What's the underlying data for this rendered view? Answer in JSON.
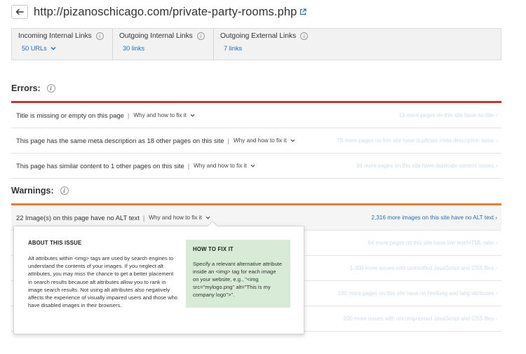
{
  "header": {
    "url": "http://pizanoschicago.com/private-party-rooms.php"
  },
  "stats": [
    {
      "label": "Incoming Internal Links",
      "value": "50 URLs"
    },
    {
      "label": "Outgoing Internal Links",
      "value": "30 links"
    },
    {
      "label": "Outgoing External Links",
      "value": "7 links"
    }
  ],
  "errors": {
    "title": "Errors:",
    "items": [
      {
        "text": "Title is missing or empty on this page",
        "fix": "Why and how to fix it",
        "right": "13 more pages on this site have no title ›"
      },
      {
        "text": "This page has the same meta description as 18 other pages on this site",
        "fix": "Why and how to fix it",
        "right": "78 more pages on this site have duplicate meta description issue ›"
      },
      {
        "text": "This page has similar content to 1 other pages on this site",
        "fix": "Why and how to fix it",
        "right": "94 more pages on this site have duplicate content issues ›"
      }
    ]
  },
  "warnings": {
    "title": "Warnings:",
    "items": [
      {
        "text": "22 Image(s) on this page have no ALT text",
        "fix": "Why and how to fix it",
        "right": "2,316 more images on this site have no ALT text ›"
      },
      {
        "right": "64 more pages on this site have low text/HTML ratio ›"
      },
      {
        "right": "1,000 more issues with unminified JavaScript and CSS files ›"
      },
      {
        "right": "100 more pages on this site have no hreflang and lang attributes ›"
      },
      {
        "right": "200 more issues with uncompressed JavaScript and CSS files ›"
      }
    ]
  },
  "popover": {
    "about_title": "ABOUT THIS ISSUE",
    "about_text": "Alt attributes within <img> tags are used by search engines to understand the contents of your images. If you neglect alt attributes, you may miss the chance to get a better placement in search results because alt attributes allow you to rank in image search results. Not using alt attributes also negatively affects the experience of visually impaired users and those who have disabled images in their browsers.",
    "howto_title": "HOW TO FIX IT",
    "howto_text": "Specify a relevant alternative attribute inside an <img> tag for each image on your website, e.g., \"<img src=\"mylogo.png\" alt=\"This is my company logo\">\"."
  },
  "colors": {
    "accent_link": "#1f6fba",
    "error_bar": "#c0392b",
    "warning_bar": "#ee7d32",
    "howto_bg": "#d8ebd6"
  }
}
